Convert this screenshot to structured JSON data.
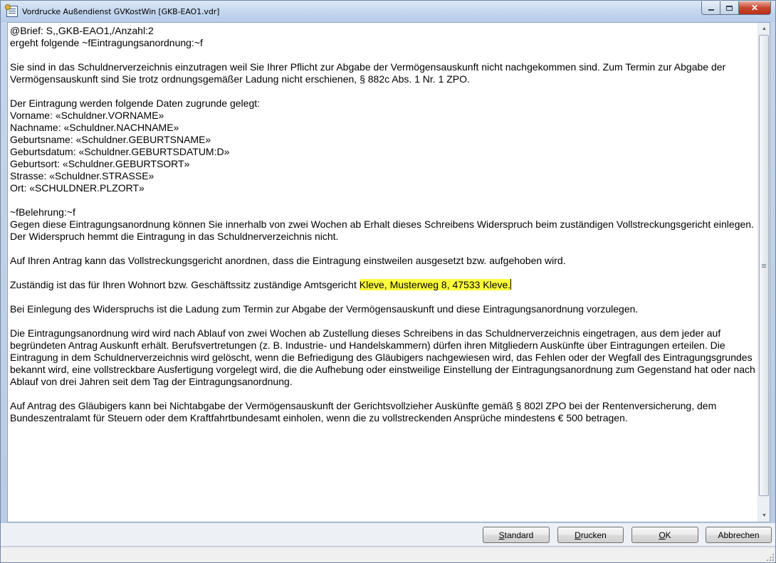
{
  "window": {
    "title": "Vordrucke Außendienst GVKostWin  [GKB-EAO1.vdr]",
    "controls": {
      "minimize": "minimize",
      "maximize": "maximize",
      "close": "x"
    }
  },
  "document": {
    "lines": {
      "l1": "@Brief: S,,GKB-EAO1,/Anzahl:2",
      "l2": "ergeht folgende ~fEintragungsanordnung:~f",
      "p1": "Sie sind in das Schuldnerverzeichnis einzutragen weil Sie Ihrer Pflicht zur Abgabe der Vermögensauskunft nicht nachgekommen sind. Zum Termin zur Abgabe der Vermögensauskunft sind Sie trotz ordnungsgemäßer Ladung nicht erschienen, § 882c Abs. 1 Nr. 1 ZPO.",
      "d0": "Der Eintragung werden folgende Daten zugrunde gelegt:",
      "d1": "Vorname: «Schuldner.VORNAME»",
      "d2": "Nachname: «Schuldner.NACHNAME»",
      "d3": "Geburtsname: «Schuldner.GEBURTSNAME»",
      "d4": "Geburtsdatum: «Schuldner.GEBURTSDATUM:D»",
      "d5": "Geburtsort: «Schuldner.GEBURTSORT»",
      "d6": "Strasse: «Schuldner.STRASSE»",
      "d7": "Ort: «SCHULDNER.PLZORT»",
      "b0": "~fBelehrung:~f",
      "b1": "Gegen diese Eintragungsanordnung können Sie innerhalb von zwei Wochen ab Erhalt dieses Schreibens Widerspruch beim zuständigen Vollstreckungsgericht einlegen. Der Widerspruch hemmt die Eintragung in das Schuldnerverzeichnis nicht.",
      "p2": "Auf Ihren Antrag kann das Vollstreckungsgericht anordnen, dass die Eintragung einstweilen ausgesetzt bzw. aufgehoben wird.",
      "p3_prefix": "Zuständig ist das für Ihren Wohnort bzw. Geschäftssitz zuständige Amtsgericht ",
      "p3_highlight": "Kleve, Musterweg 8, 47533 Kleve.",
      "p4": "Bei Einlegung des Widerspruchs ist die Ladung zum Termin zur Abgabe der Vermögensauskunft und diese Eintragungsanordnung vorzulegen.",
      "p5": "Die Eintragungsanordnung wird wird nach Ablauf von zwei Wochen ab Zustellung dieses Schreibens in das Schuldnerverzeichnis eingetragen, aus dem jeder auf begründeten Antrag Auskunft erhält. Berufsvertretungen (z. B. Industrie- und Handelskammern) dürfen ihren Mitgliedern Auskünfte über Eintragungen erteilen. Die Eintragung in dem Schuldnerverzeichnis wird gelöscht, wenn die Befriedigung des Gläubigers nachgewiesen wird, das Fehlen oder der Wegfall des Eintragungsgrundes bekannt wird, eine vollstreckbare Ausfertigung vorgelegt wird, die die Aufhebung oder einstweilige Einstellung der Eintragungsanordnung zum Gegenstand hat oder nach Ablauf von drei Jahren seit dem Tag der Eintragungsanordnung.",
      "p6": "Auf Antrag des Gläubigers kann bei Nichtabgabe der Vermögensauskunft der Gerichtsvollzieher Auskünfte gemäß § 802l ZPO bei der Rentenversicherung, dem Bundeszentralamt für Steuern oder dem Kraftfahrtbundesamt einholen, wenn die zu vollstreckenden Ansprüche mindestens € 500 betragen."
    },
    "highlight_color": "#ffff3d"
  },
  "buttons": {
    "standard": {
      "hot": "S",
      "rest": "tandard"
    },
    "drucken": {
      "hot": "D",
      "rest": "rucken"
    },
    "ok": {
      "hot": "O",
      "rest": "K"
    },
    "abbrechen": "Abbrechen"
  }
}
